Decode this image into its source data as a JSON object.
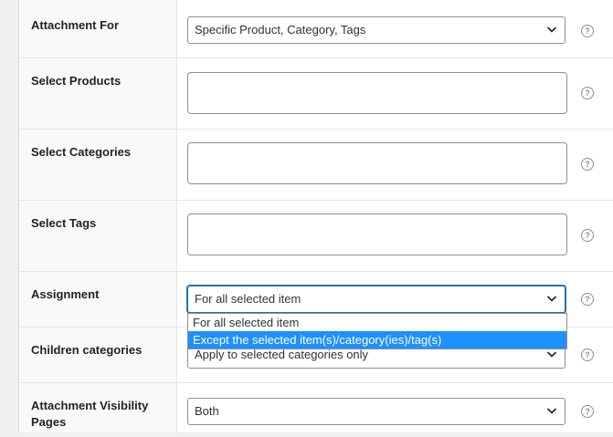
{
  "fields": {
    "attachment_for": {
      "label": "Attachment For",
      "value": "Specific Product, Category, Tags"
    },
    "select_products": {
      "label": "Select Products"
    },
    "select_categories": {
      "label": "Select Categories"
    },
    "select_tags": {
      "label": "Select Tags"
    },
    "assignment": {
      "label": "Assignment",
      "value": "For all selected item",
      "options": [
        "For all selected item",
        "Except the selected item(s)/category(ies)/tag(s)"
      ],
      "highlighted_option_index": 1
    },
    "children_categories": {
      "label": "Children categories",
      "value": "Apply to selected categories only"
    },
    "attachment_visibility_pages": {
      "label": "Attachment Visibility Pages",
      "value": "Both"
    }
  },
  "help_glyph": "?",
  "icons": {
    "help": "question-circle-icon",
    "chevron": "chevron-down-icon"
  },
  "colors": {
    "accent": "#2271b1",
    "option_highlight": "#1e90ff"
  }
}
